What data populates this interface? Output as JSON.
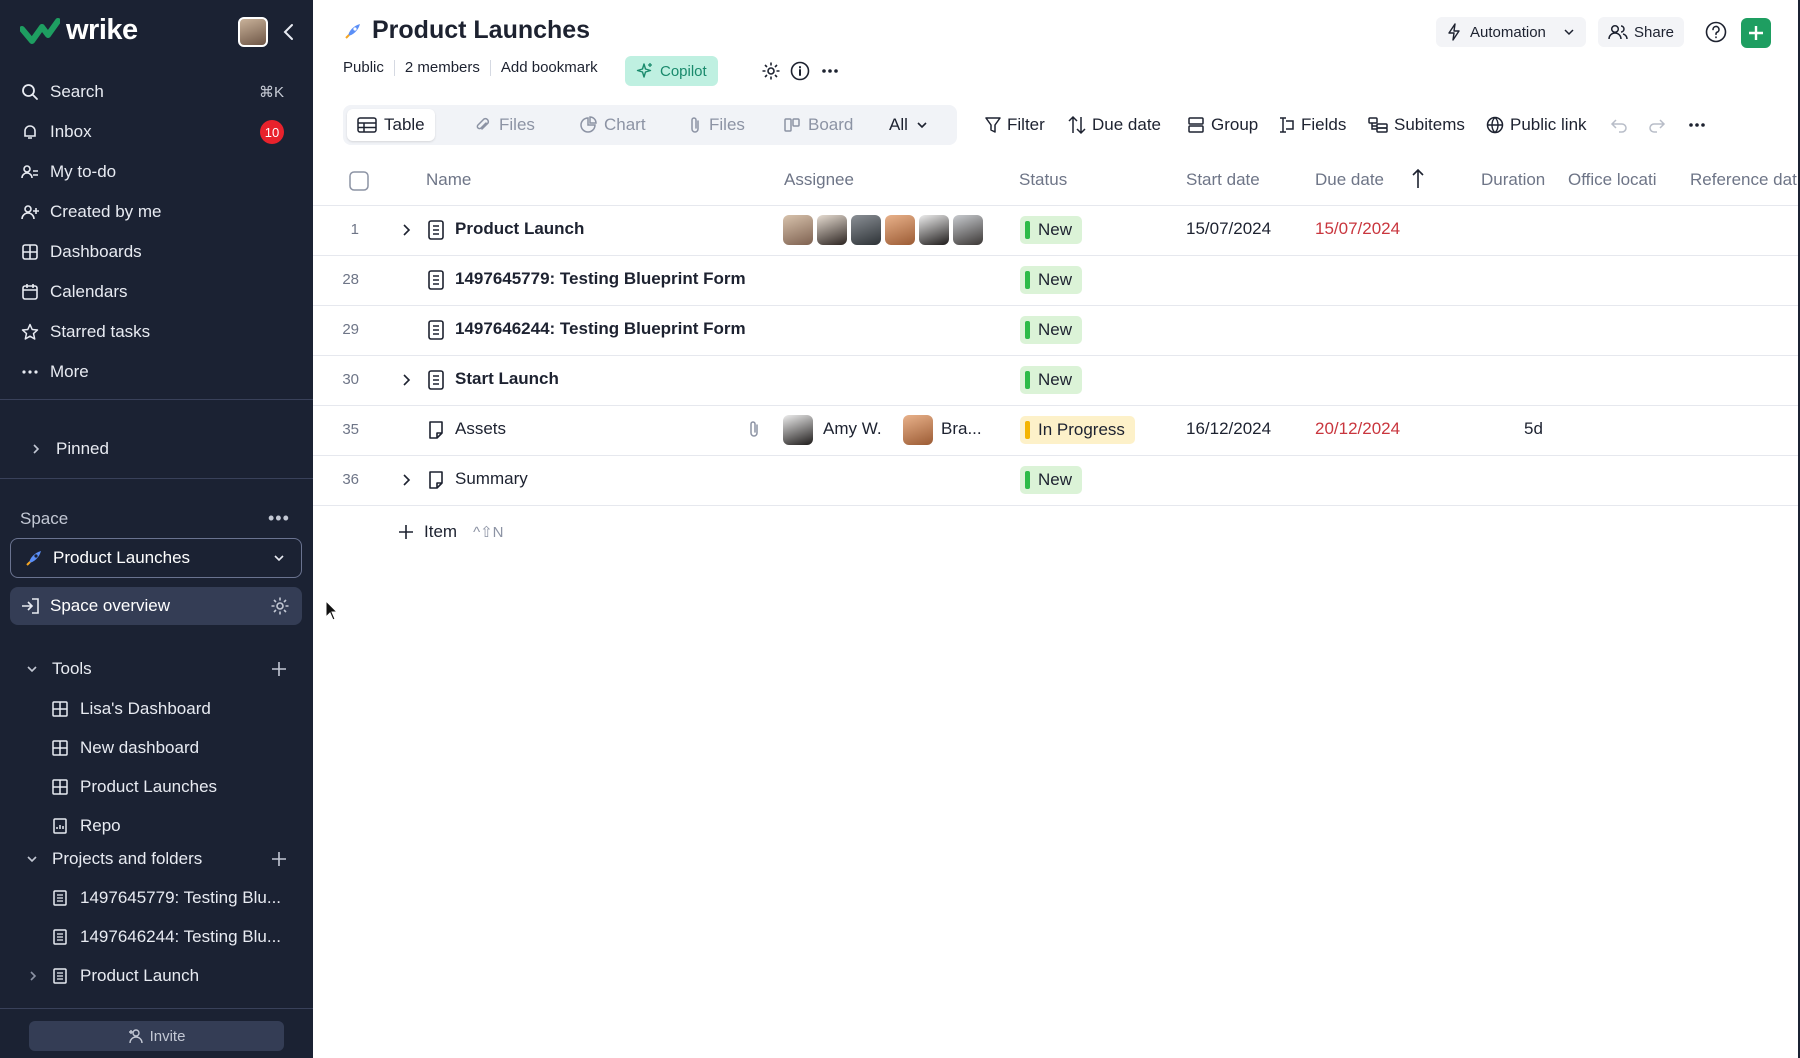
{
  "app": {
    "logo_text": "wrike",
    "brand_color": "#1e9e61"
  },
  "sidebar": {
    "nav": [
      {
        "label": "Search",
        "icon": "search-icon",
        "shortcut": "⌘K"
      },
      {
        "label": "Inbox",
        "icon": "bell-icon",
        "badge": "10"
      },
      {
        "label": "My to-do",
        "icon": "todo-icon"
      },
      {
        "label": "Created by me",
        "icon": "user-plus-icon"
      },
      {
        "label": "Dashboards",
        "icon": "dashboard-icon"
      },
      {
        "label": "Calendars",
        "icon": "calendar-icon"
      },
      {
        "label": "Starred tasks",
        "icon": "star-icon"
      },
      {
        "label": "More",
        "icon": "ellipsis-icon"
      }
    ],
    "pinned_label": "Pinned",
    "space_label": "Space",
    "space_selected": "Product Launches",
    "space_overview": "Space overview",
    "tools_label": "Tools",
    "tools": [
      "Lisa's Dashboard",
      "New dashboard",
      "Product Launches",
      "Repo"
    ],
    "projects_label": "Projects and folders",
    "projects": [
      "1497645779: Testing Blu...",
      "1497646244: Testing Blu...",
      "Product Launch"
    ],
    "invite_label": "Invite"
  },
  "header": {
    "title": "Product Launches",
    "visibility": "Public",
    "members": "2 members",
    "bookmark": "Add bookmark",
    "copilot": "Copilot",
    "automation": "Automation",
    "share": "Share"
  },
  "views": {
    "tabs": [
      "Table",
      "Files",
      "Chart",
      "Files",
      "Board"
    ],
    "active": "Table",
    "all_label": "All"
  },
  "toolbar": {
    "filter": "Filter",
    "sort": "Due date",
    "group": "Group",
    "fields": "Fields",
    "subitems": "Subitems",
    "public_link": "Public link"
  },
  "table": {
    "columns": [
      "Name",
      "Assignee",
      "Status",
      "Start date",
      "Due date",
      "Duration",
      "Office locati",
      "Reference dat"
    ],
    "rows": [
      {
        "num": "1",
        "name": "Product Launch",
        "status": "New",
        "start": "15/07/2024",
        "due": "15/07/2024",
        "duration": ""
      },
      {
        "num": "28",
        "name": "1497645779: Testing Blueprint Form",
        "status": "New",
        "start": "",
        "due": "",
        "duration": ""
      },
      {
        "num": "29",
        "name": "1497646244: Testing Blueprint Form",
        "status": "New",
        "start": "",
        "due": "",
        "duration": ""
      },
      {
        "num": "30",
        "name": "Start Launch",
        "status": "New",
        "start": "",
        "due": "",
        "duration": ""
      },
      {
        "num": "35",
        "name": "Assets",
        "status": "In Progress",
        "start": "16/12/2024",
        "due": "20/12/2024",
        "duration": "5d",
        "assignees": [
          "Amy W.",
          "Bra..."
        ]
      },
      {
        "num": "36",
        "name": "Summary",
        "status": "New",
        "start": "",
        "due": "",
        "duration": ""
      }
    ],
    "add_item": "Item",
    "add_item_shortcut": "^⇧N"
  }
}
